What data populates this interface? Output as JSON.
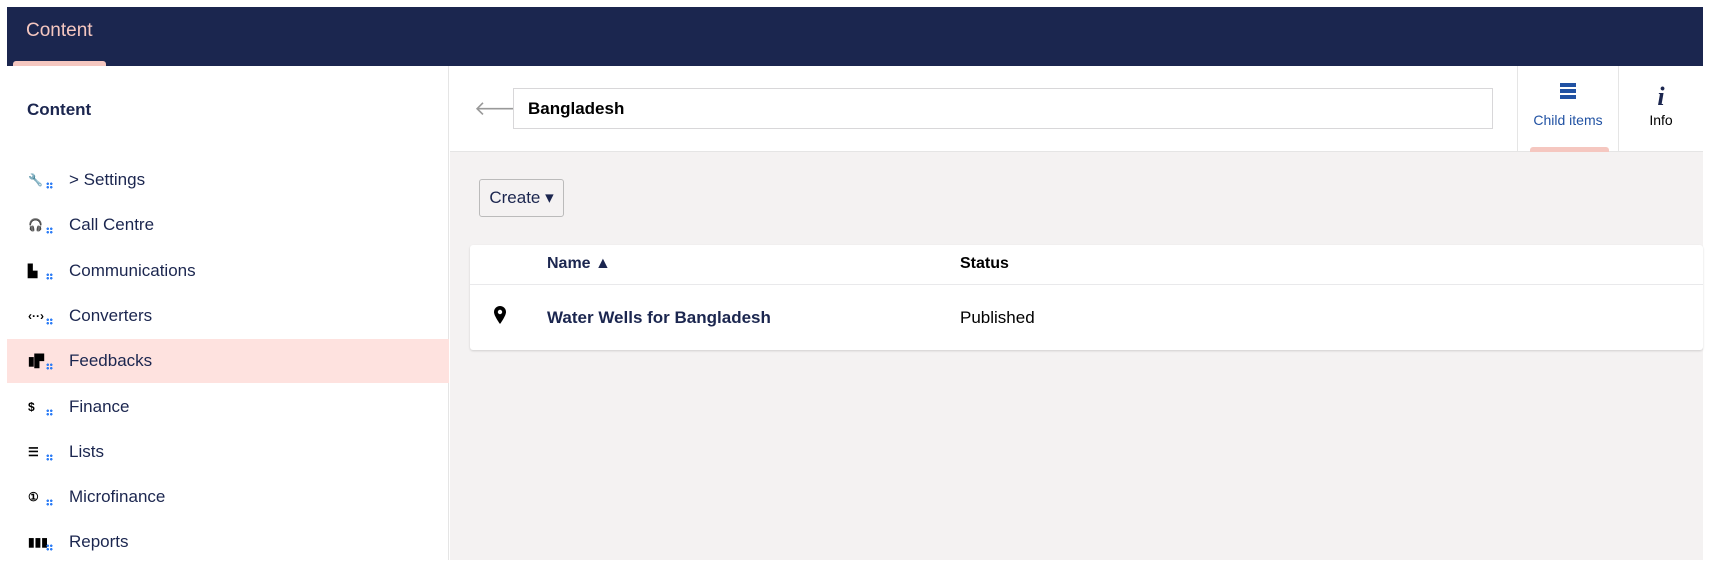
{
  "header": {
    "section": "Content"
  },
  "sidebar": {
    "title": "Content",
    "items": [
      {
        "label": "> Settings",
        "icon": "wrench-icon",
        "glyph": "🔧"
      },
      {
        "label": "Call Centre",
        "icon": "headset-icon",
        "glyph": "🎧"
      },
      {
        "label": "Communications",
        "icon": "inbox-icon",
        "glyph": "▙"
      },
      {
        "label": "Converters",
        "icon": "code-arrows-icon",
        "glyph": "‹··›"
      },
      {
        "label": "Feedbacks",
        "icon": "feedback-icon",
        "glyph": "▮▛"
      },
      {
        "label": "Finance",
        "icon": "coins-icon",
        "glyph": "$"
      },
      {
        "label": "Lists",
        "icon": "numbered-list-icon",
        "glyph": "☰"
      },
      {
        "label": "Microfinance",
        "icon": "coin-icon",
        "glyph": "①"
      },
      {
        "label": "Reports",
        "icon": "books-icon",
        "glyph": "▮▮▮"
      }
    ],
    "active_index": 4
  },
  "editor": {
    "back_icon": "arrow-left-icon",
    "name_value": "Bangladesh"
  },
  "apps": {
    "child_items": "Child items",
    "info": "Info",
    "active": "child_items"
  },
  "toolbar": {
    "create_label": "Create ▾"
  },
  "table": {
    "columns": {
      "name": "Name ▲",
      "status": "Status"
    },
    "rows": [
      {
        "icon": "map-pin-icon",
        "name": "Water Wells for Bangladesh",
        "status": "Published"
      }
    ]
  },
  "colors": {
    "header_bg": "#1b264f",
    "accent": "#f5c7c0",
    "active_item_bg": "#fee2df",
    "link_blue": "#2152a3"
  }
}
